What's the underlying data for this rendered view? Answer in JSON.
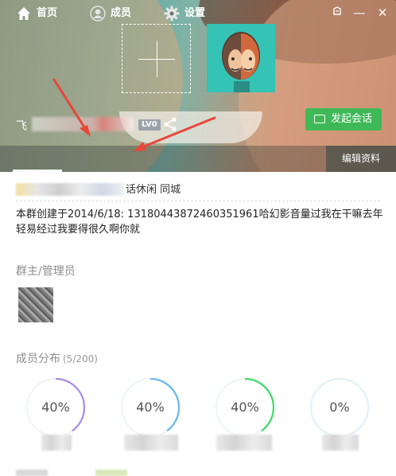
{
  "window": {
    "skin_icon": "skin-icon",
    "minimize_label": "—",
    "close_label": "✕"
  },
  "header": {
    "name_prefix": "飞",
    "level_badge": "LV0",
    "chat_button": "发起会话",
    "edit_button": "编辑资料",
    "tabs": [
      {
        "label": "首页",
        "icon": "home-icon"
      },
      {
        "label": "成员",
        "icon": "person-icon"
      },
      {
        "label": "设置",
        "icon": "gear-icon"
      }
    ]
  },
  "info": {
    "tags_text": "话休闲  同城",
    "description": "本群创建于2014/6/18:  13180443872460351961哈幻影音量过我在干嘛去年轻易经过我要得很久啊你就"
  },
  "admins": {
    "title": "群主/管理员"
  },
  "distribution": {
    "title": "成员分布",
    "count": "(5/200)",
    "items": [
      {
        "percent": "40%",
        "value": 0.4,
        "color": "#a98be6"
      },
      {
        "percent": "40%",
        "value": 0.4,
        "color": "#66b8f0"
      },
      {
        "percent": "40%",
        "value": 0.4,
        "color": "#3ed86a"
      },
      {
        "percent": "0%",
        "value": 0.0,
        "color": "#c9e8f6"
      }
    ]
  },
  "colors": {
    "accent_green": "#3fb858",
    "header_teal": "#3a8c8a",
    "arrow_red": "#e8463a"
  }
}
